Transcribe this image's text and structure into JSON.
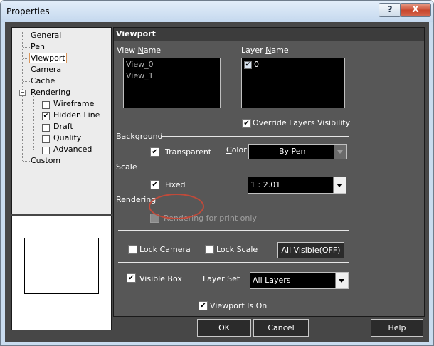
{
  "window": {
    "title": "Properties",
    "help_glyph": "?",
    "close_glyph": "X"
  },
  "tree": {
    "items": [
      {
        "label": "General"
      },
      {
        "label": "Pen"
      },
      {
        "label": "Viewport"
      },
      {
        "label": "Camera"
      },
      {
        "label": "Cache"
      },
      {
        "label": "Rendering"
      },
      {
        "label": "Wireframe"
      },
      {
        "label": "Hidden Line"
      },
      {
        "label": "Draft"
      },
      {
        "label": "Quality"
      },
      {
        "label": "Advanced"
      },
      {
        "label": "Custom"
      }
    ],
    "selected": "Viewport",
    "expander_glyph": "−",
    "hidden_line_checked": true
  },
  "panel": {
    "title": "Viewport",
    "view_name_label": "View Name",
    "view_name_mnemonic": "N",
    "view_names": [
      "View_0",
      "View_1"
    ],
    "layer_name_label": "Layer Name",
    "layer_name_mnemonic": "N",
    "layers": [
      {
        "name": "0",
        "checked": true
      }
    ],
    "override_layers_visibility": {
      "label": "Override Layers Visibility",
      "checked": true
    },
    "background": {
      "section_label": "Background",
      "transparent": {
        "label": "Transparent",
        "checked": true
      },
      "color_label": "Color",
      "color_mnemonic": "C",
      "color_value": "By Pen"
    },
    "scale": {
      "section_label": "Scale",
      "fixed": {
        "label": "Fixed",
        "checked": true
      },
      "value": "1 : 2.01"
    },
    "rendering": {
      "section_label": "Rendering",
      "print_only": {
        "label": "Rendering for print only",
        "checked": false,
        "enabled": false
      }
    },
    "lock_camera": {
      "label": "Lock Camera",
      "checked": false
    },
    "lock_scale": {
      "label": "Lock Scale",
      "checked": false
    },
    "all_visible_button": "All Visible(OFF)",
    "visible_box": {
      "label": "Visible Box",
      "checked": true
    },
    "layer_set_label": "Layer Set",
    "layer_set_value": "All Layers",
    "viewport_is_on": {
      "label": "Viewport Is On",
      "checked": true
    }
  },
  "footer": {
    "ok": "OK",
    "cancel": "Cancel",
    "help": "Help"
  },
  "check_glyph": "✔",
  "colors": {
    "panel_bg": "#575757",
    "dialog_bg": "#474747",
    "annotation": "#c04a3a",
    "selection_border": "#d9955a"
  }
}
